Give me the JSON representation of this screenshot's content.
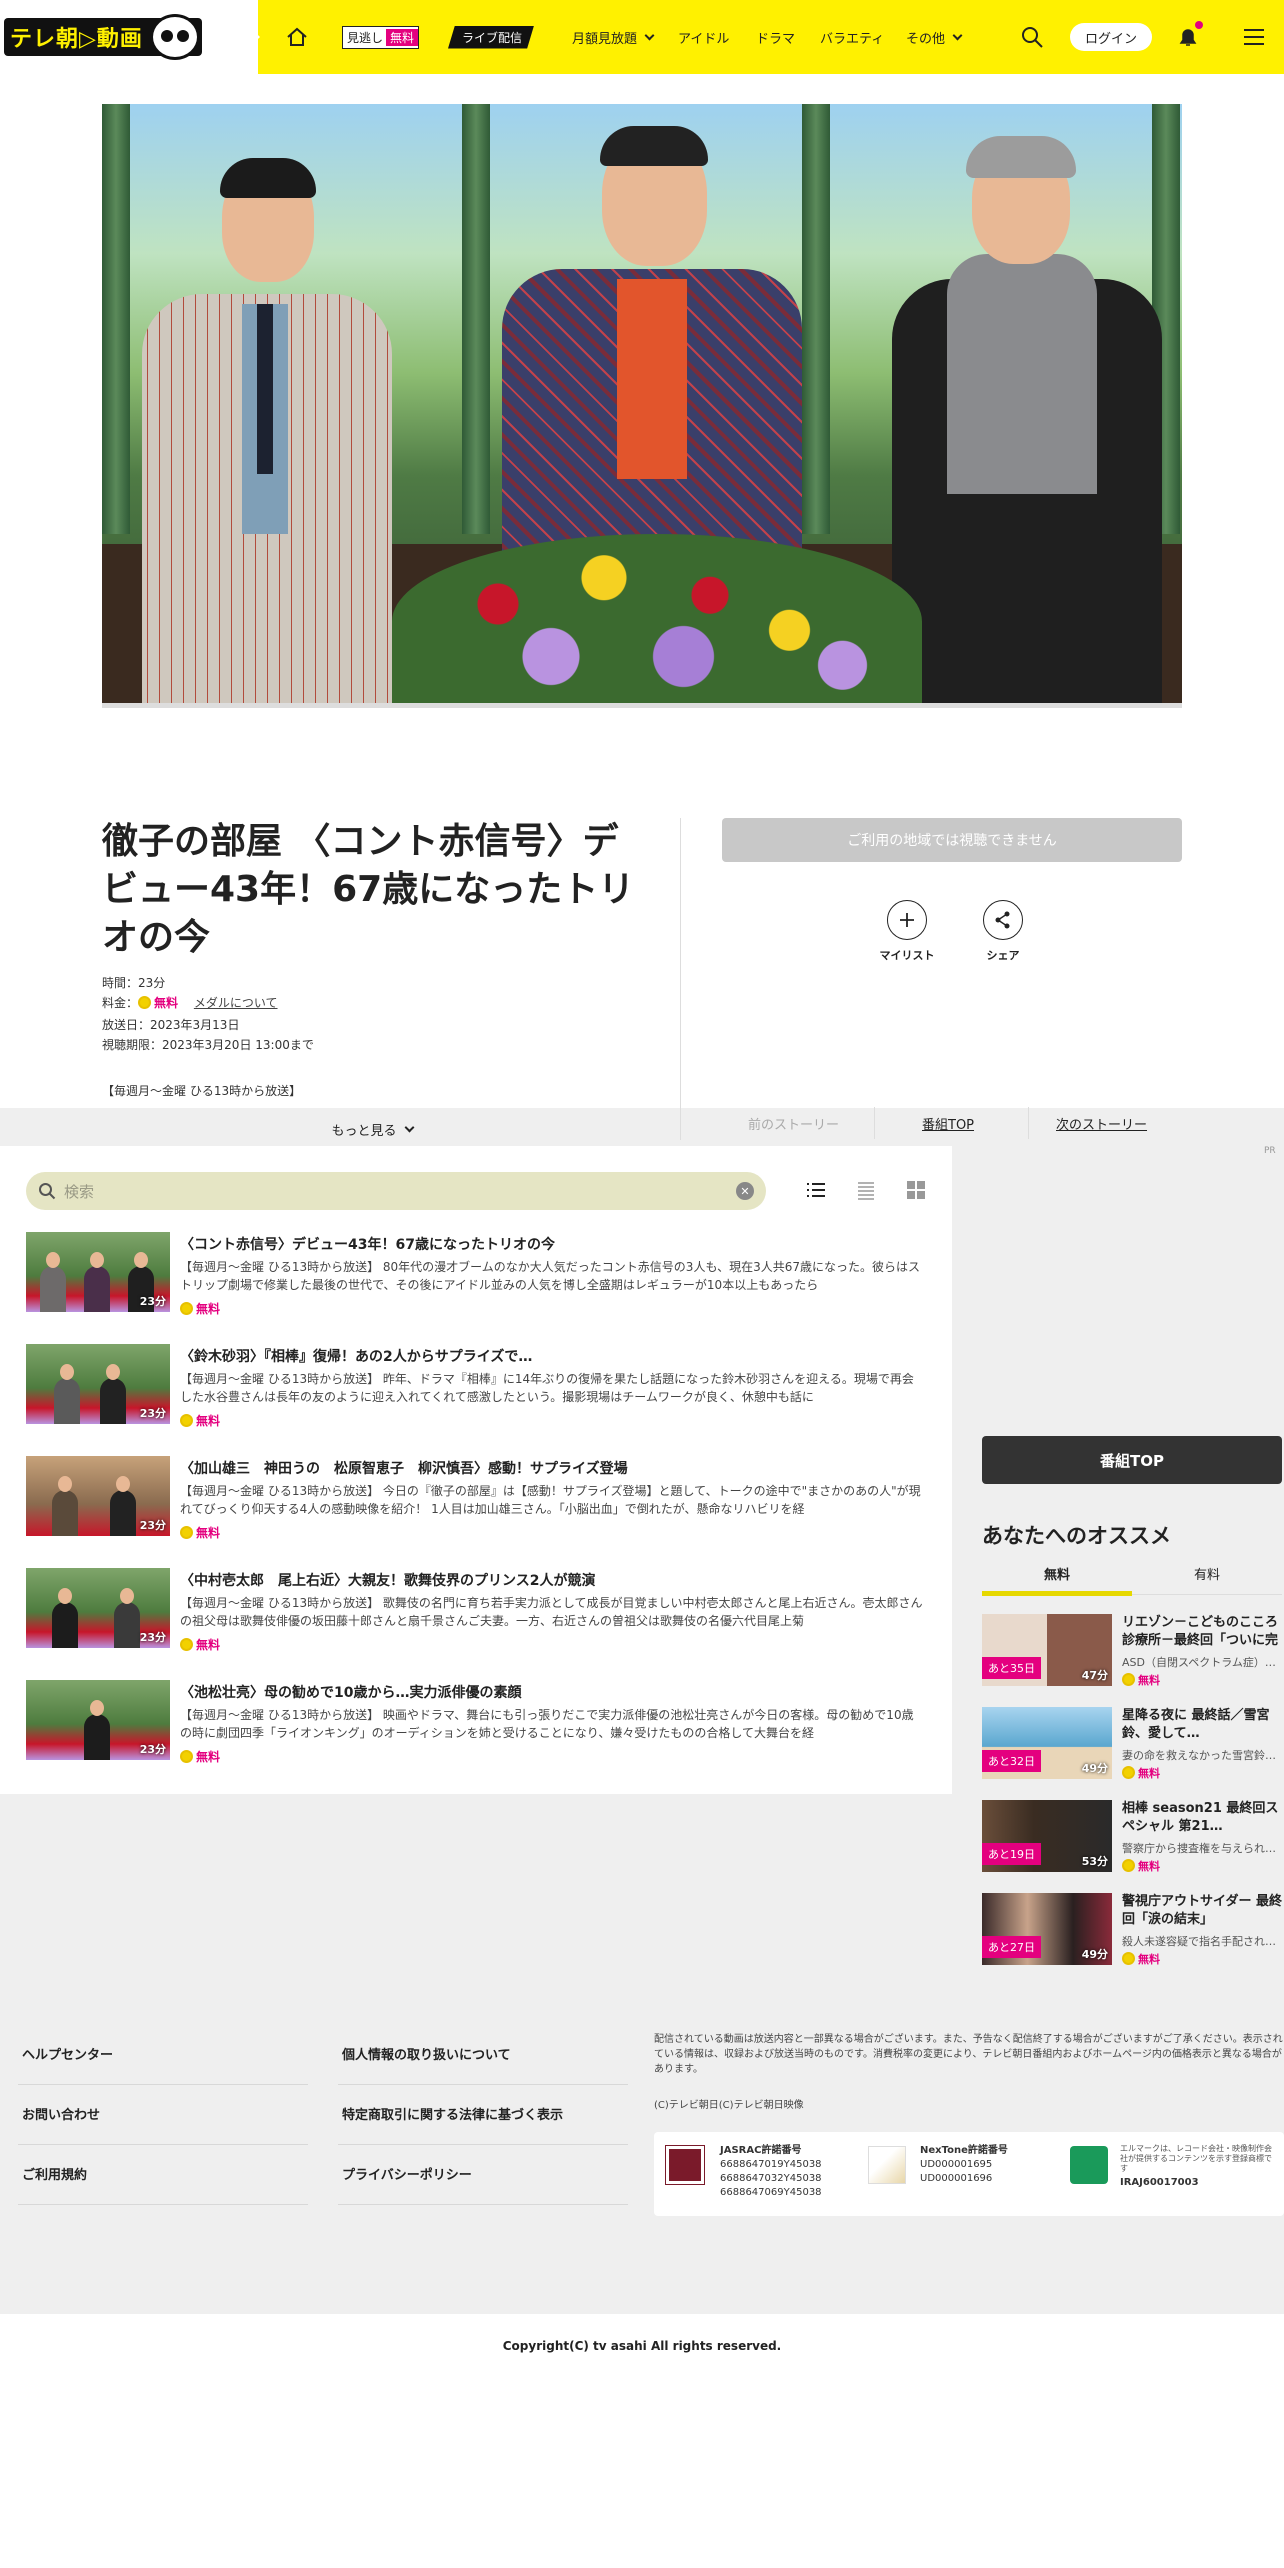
{
  "header": {
    "logo_text": "テレ朝▷動画",
    "nav": {
      "free_tag_left": "見逃し",
      "free_tag_right": "無料",
      "live": "ライブ配信",
      "monthly": "月額見放題",
      "idol": "アイドル",
      "drama": "ドラマ",
      "variety": "バラエティ",
      "other": "その他"
    },
    "login": "ログイン",
    "icons": [
      "home-icon",
      "search-icon",
      "bell-icon",
      "menu-icon"
    ]
  },
  "episode": {
    "title": "徹子の部屋 〈コント赤信号〉デビュー43年！67歳になったトリオの今",
    "duration": "時間：23分",
    "fee_label": "料金：",
    "fee_value": "無料",
    "medal_link": "メダルについて",
    "air_date": "放送日：2023年3月13日",
    "limit": "視聴期限：2023年3月20日 13:00まで",
    "schedule": "【毎週月～金曜 ひる13時から放送】",
    "more": "もっと見る",
    "unavailable": "ご利用の地域では視聴できません",
    "mylist": "マイリスト",
    "share": "シェア",
    "prev_story": "前のストーリー",
    "program_top": "番組TOP",
    "next_story": "次のストーリー"
  },
  "list": {
    "search_placeholder": "検索",
    "view_icons": [
      "list-view-icon",
      "compact-list-icon",
      "grid-view-icon"
    ],
    "items": [
      {
        "title": "〈コント赤信号〉デビュー43年！67歳になったトリオの今",
        "desc": "【毎週月～金曜 ひる13時から放送】 80年代の漫才ブームのなか大人気だったコント赤信号の3人も、現在3人共67歳になった。彼らはストリップ劇場で修業した最後の世代で、その後にアイドル並みの人気を博し全盛期はレギュラーが10本以上もあったら",
        "duration": "23分",
        "fee": "無料"
      },
      {
        "title": "〈鈴木砂羽〉『相棒』復帰！あの2人からサプライズで…",
        "desc": "【毎週月～金曜 ひる13時から放送】 昨年、ドラマ『相棒』に14年ぶりの復帰を果たし話題になった鈴木砂羽さんを迎える。現場で再会した水谷豊さんは長年の友のように迎え入れてくれて感激したという。撮影現場はチームワークが良く、休憩中も話に",
        "duration": "23分",
        "fee": "無料"
      },
      {
        "title": "〈加山雄三　神田うの　松原智恵子　柳沢慎吾〉感動！サプライズ登場",
        "desc": "【毎週月～金曜 ひる13時から放送】 今日の『徹子の部屋』は【感動！サプライズ登場】と題して、トークの途中で\"まさかのあの人\"が現れてびっくり仰天する4人の感動映像を紹介！ 1人目は加山雄三さん。「小脳出血」で倒れたが、懸命なリハビリを経",
        "duration": "23分",
        "fee": "無料"
      },
      {
        "title": "〈中村壱太郎　尾上右近〉大親友！歌舞伎界のプリンス2人が競演",
        "desc": "【毎週月～金曜 ひる13時から放送】 歌舞伎の名門に育ち若手実力派として成長が目覚ましい中村壱太郎さんと尾上右近さん。壱太郎さんの祖父母は歌舞伎俳優の坂田藤十郎さんと扇千景さんご夫妻。一方、右近さんの曽祖父は歌舞伎の名優六代目尾上菊",
        "duration": "23分",
        "fee": "無料"
      },
      {
        "title": "〈池松壮亮〉母の勧めで10歳から…実力派俳優の素顔",
        "desc": "【毎週月～金曜 ひる13時から放送】 映画やドラマ、舞台にも引っ張りだこで実力派俳優の池松壮亮さんが今日の客様。母の勧めで10歳の時に劇団四季「ライオンキング」のオーディションを姉と受けることになり、嫌々受けたものの合格して大舞台を経",
        "duration": "23分",
        "fee": "無料"
      }
    ]
  },
  "sidebar": {
    "pr": "PR",
    "program_top": "番組TOP",
    "recommend_title": "あなたへのオススメ",
    "tabs": [
      "無料",
      "有料"
    ],
    "items": [
      {
        "title": "リエゾン－こどものこころ診療所－最終回「ついに完結！「こ…",
        "sub": "ASD（自閉スペクトラム症）…",
        "days": "あと35日",
        "duration": "47分",
        "fee": "無料"
      },
      {
        "title": "星降る夜に 最終話／雪宮鈴、愛して…",
        "sub": "妻の命を救えなかった雪宮鈴…",
        "days": "あと32日",
        "duration": "49分",
        "fee": "無料"
      },
      {
        "title": "相棒 season21 最終回スペシャル 第21…",
        "sub": "警察庁から捜査権を与えられ…",
        "days": "あと19日",
        "duration": "53分",
        "fee": "無料"
      },
      {
        "title": "警視庁アウトサイダー 最終回「涙の結末」",
        "sub": "殺人未遂容疑で指名手配され…",
        "days": "あと27日",
        "duration": "49分",
        "fee": "無料"
      }
    ]
  },
  "footer": {
    "links": [
      "ヘルプセンター",
      "お問い合わせ",
      "ご利用規約",
      "個人情報の取り扱いについて",
      "特定商取引に関する法律に基づく表示",
      "プライバシーポリシー"
    ],
    "note": "配信されている動画は放送内容と一部異なる場合がございます。また、予告なく配信終了する場合がございますがご了承ください。表示されている情報は、収録および放送当時のものです。消費税率の変更により、テレビ朝日番組内およびホームページ内の価格表示と異なる場合があります。",
    "copy1": "(C)テレビ朝日(C)テレビ朝日映像",
    "jasrac_title": "JASRAC許諾番号",
    "jasrac_nums": [
      "6688647019Y45038",
      "6688647032Y45038",
      "6688647069Y45038"
    ],
    "nextone_title": "NexTone許諾番号",
    "nextone_nums": [
      "UD000001695",
      "UD000001696"
    ],
    "lmark_desc": "エルマークは、レコード会社・映像制作会社が提供するコンテンツを示す登録商標です",
    "lmark_num": "IRAJ60017003",
    "copyright": "Copyright(C) tv asahi All rights reserved."
  },
  "colors": {
    "brand_yellow": "#fff100",
    "free_pink": "#e4007f",
    "coin": "#f2d100"
  }
}
